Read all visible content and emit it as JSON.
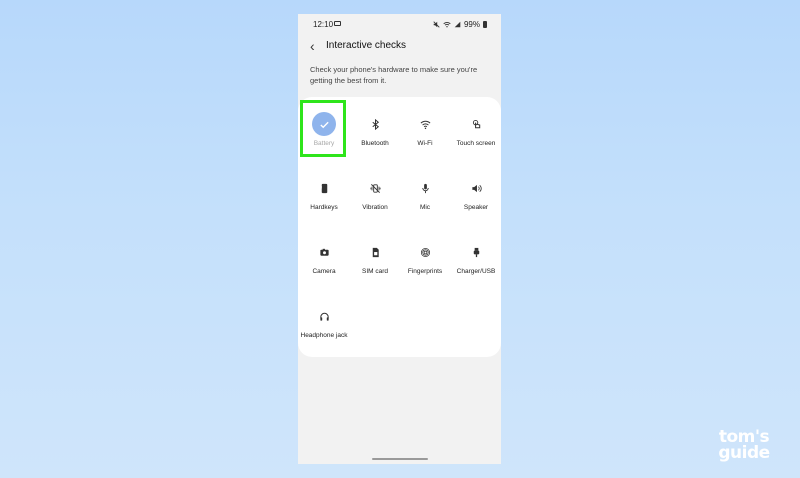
{
  "status_bar": {
    "time": "12:10",
    "battery": "99%"
  },
  "header": {
    "title": "Interactive checks"
  },
  "description": "Check your phone's hardware to make sure you're getting the best from it.",
  "checks": [
    {
      "label": "Battery",
      "icon": "check-icon",
      "state": "selected"
    },
    {
      "label": "Bluetooth",
      "icon": "bluetooth-icon"
    },
    {
      "label": "Wi-Fi",
      "icon": "wifi-icon"
    },
    {
      "label": "Touch screen",
      "icon": "touch-icon"
    },
    {
      "label": "Hardkeys",
      "icon": "hardkeys-icon"
    },
    {
      "label": "Vibration",
      "icon": "vibration-icon"
    },
    {
      "label": "Mic",
      "icon": "mic-icon"
    },
    {
      "label": "Speaker",
      "icon": "speaker-icon"
    },
    {
      "label": "Camera",
      "icon": "camera-icon"
    },
    {
      "label": "SIM card",
      "icon": "sim-card-icon"
    },
    {
      "label": "Fingerprints",
      "icon": "fingerprint-icon"
    },
    {
      "label": "Charger/USB",
      "icon": "usb-icon"
    },
    {
      "label": "Headphone jack",
      "icon": "headphone-icon"
    }
  ],
  "watermark": {
    "line1": "tom's",
    "line2": "guide"
  },
  "colors": {
    "selected_circle": "#8fb4ec",
    "highlight_box": "#2ee51b",
    "background": "#c4e0fb"
  }
}
